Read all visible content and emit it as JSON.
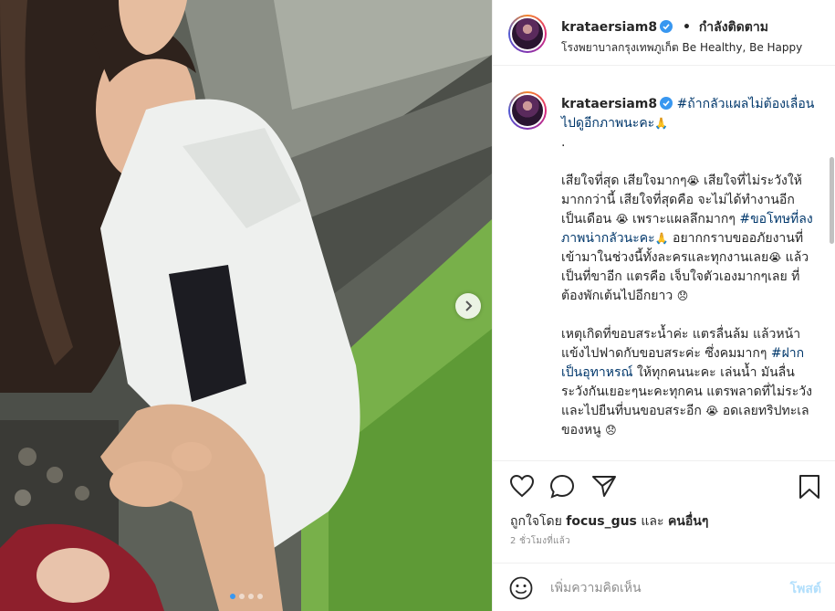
{
  "header": {
    "username": "krataersiam8",
    "separator": "•",
    "follow_status": "กำลังติดตาม",
    "location": "โรงพยาบาลกรุงเทพภูเก็ต Be Healthy, Be Happy"
  },
  "caption": {
    "username": "krataersiam8",
    "hashtag1": "#ถ้ากลัวแผลไม่ต้องเลื่อนไปดูอีกภาพนะคะ",
    "pray": "🙏",
    "dot": ".",
    "p1_a": "เสียใจที่สุด เสียใจมากๆ",
    "sob1": "😭",
    "p1_b": " เสียใจที่ไม่ระวังให้มากกว่านี้ เสียใจที่สุดคือ จะไม่ได้ทำงานอีกเป็นเดือน ",
    "sob2": "😭",
    "p1_c": " เพราะแผลลึกมากๆ ",
    "hashtag2": "#ขอโทษที่ลงภาพน่ากลัวนะคะ",
    "pray2": "🙏",
    "p1_d": " อยากกราบขออภัยงานที่เข้ามาในช่วงนี้ทั้งละครและทุกงานเลย",
    "sob3": "😭",
    "p1_e": " แล้วเป็นที่ขาอีก แตรคือ เจ็บใจตัวเองมากๆเลย ที่ต้องพักเต้นไปอีกยาว ",
    "sad1": "😞",
    "p2_a": "เหตุเกิดที่ขอบสระน้ำค่ะ แตรลื่นล้ม แล้วหน้าแข้งไปฟาดกับขอบสระค่ะ ซึ่งคมมากๆ ",
    "hashtag3": "#ฝากเป็นอุทาหรณ์",
    "p2_b": " ให้ทุกคนนะคะ เล่นน้ำ มันลื่น ระวังกันเยอะๆนะคะทุกคน แตรพลาดที่ไม่ระวัง และไปยืนที่บนขอบสระอีก ",
    "sob4": "😭",
    "p2_c": " อดเลยทริปทะเลของหนู ",
    "sad2": "😞"
  },
  "actions": {
    "like_icon": "heart-icon",
    "comment_icon": "comment-icon",
    "share_icon": "share-icon",
    "save_icon": "bookmark-icon",
    "likes_prefix": "ถูกใจโดย",
    "liked_by_user": "focus_gus",
    "likes_and": "และ",
    "likes_others": "คนอื่นๆ",
    "time_ago": "2 ชั่วโมงที่แล้ว"
  },
  "comment": {
    "placeholder": "เพิ่มความคิดเห็น",
    "post_label": "โพสต์",
    "emoji_icon": "smiley-icon"
  },
  "carousel": {
    "current_index": 1,
    "total_slides": 4
  },
  "colors": {
    "verified": "#3897f0",
    "hashtag": "#00376b",
    "post_disabled": "#b2dffc",
    "active_dot": "#3897f0"
  }
}
